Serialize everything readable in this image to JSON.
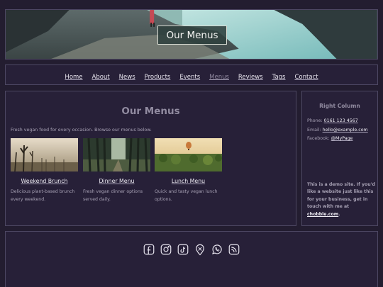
{
  "hero": {
    "title": "Our Menus"
  },
  "nav": {
    "items": [
      {
        "label": "Home"
      },
      {
        "label": "About"
      },
      {
        "label": "News"
      },
      {
        "label": "Products"
      },
      {
        "label": "Events"
      },
      {
        "label": "Menus"
      },
      {
        "label": "Reviews"
      },
      {
        "label": "Tags"
      },
      {
        "label": "Contact"
      }
    ],
    "active": "Menus"
  },
  "main": {
    "title": "Our Menus",
    "intro": "Fresh vegan food for every occasion. Browse our menus below.",
    "cards": [
      {
        "title": "Weekend Brunch",
        "desc_1": "Delicious plant-based brunch",
        "desc_2": "every weekend."
      },
      {
        "title": "Dinner Menu",
        "desc_1": "Fresh vegan dinner options",
        "desc_2": "served daily."
      },
      {
        "title": "Lunch Menu",
        "desc_1": "Quick and tasty vegan lunch",
        "desc_2": "options."
      }
    ]
  },
  "sidebar": {
    "title": "Right Column",
    "phone_label": "Phone:",
    "phone": "0161 123 4567",
    "email_label": "Email:",
    "email": "hello@example.com",
    "facebook_label": "Facebook:",
    "facebook": "@MyPage",
    "demo_text": "This is a demo site. If you'd like a website just like this for your business, get in touch with me at",
    "demo_link": "chobble.com",
    "demo_end": "."
  },
  "footer": {
    "icons": [
      "facebook-icon",
      "instagram-icon",
      "tiktok-icon",
      "map-pin-icon",
      "whatsapp-icon",
      "rss-icon"
    ]
  }
}
